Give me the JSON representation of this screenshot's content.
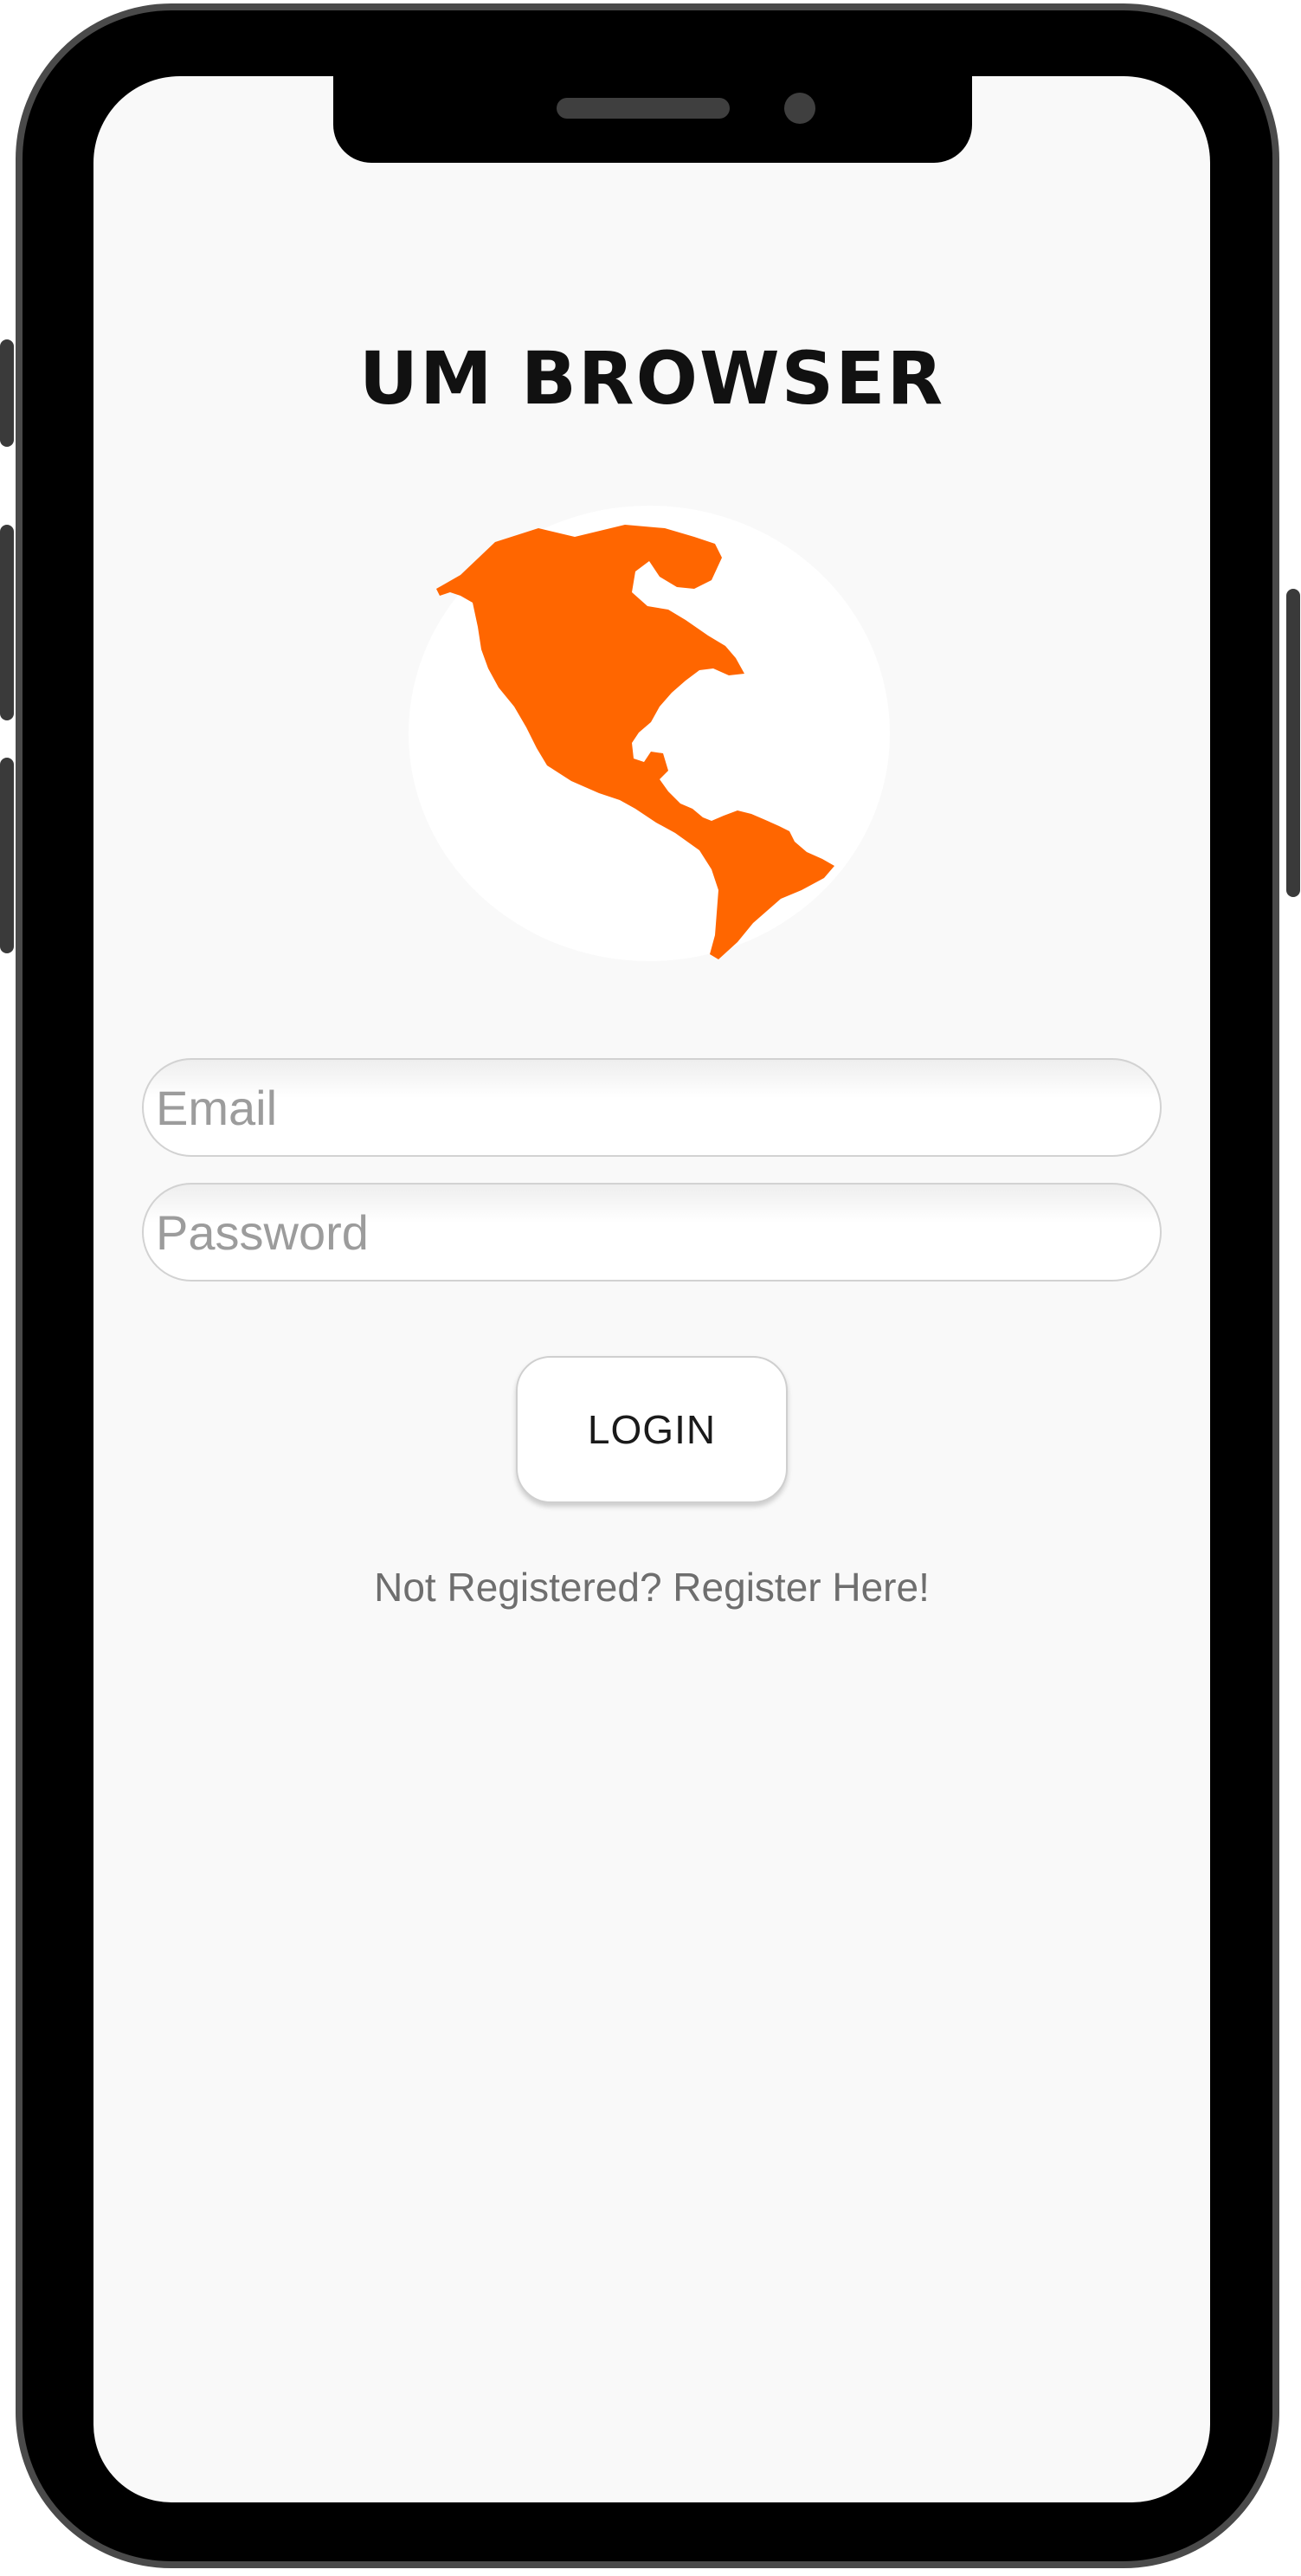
{
  "app": {
    "title": "UM BROWSER",
    "brand_color": "#FF6600"
  },
  "login_form": {
    "email_placeholder": "Email",
    "password_placeholder": "Password",
    "login_label": "LOGIN",
    "register_link": "Not Registered? Register Here!"
  },
  "icons": {
    "logo": "globe-americas-icon"
  }
}
